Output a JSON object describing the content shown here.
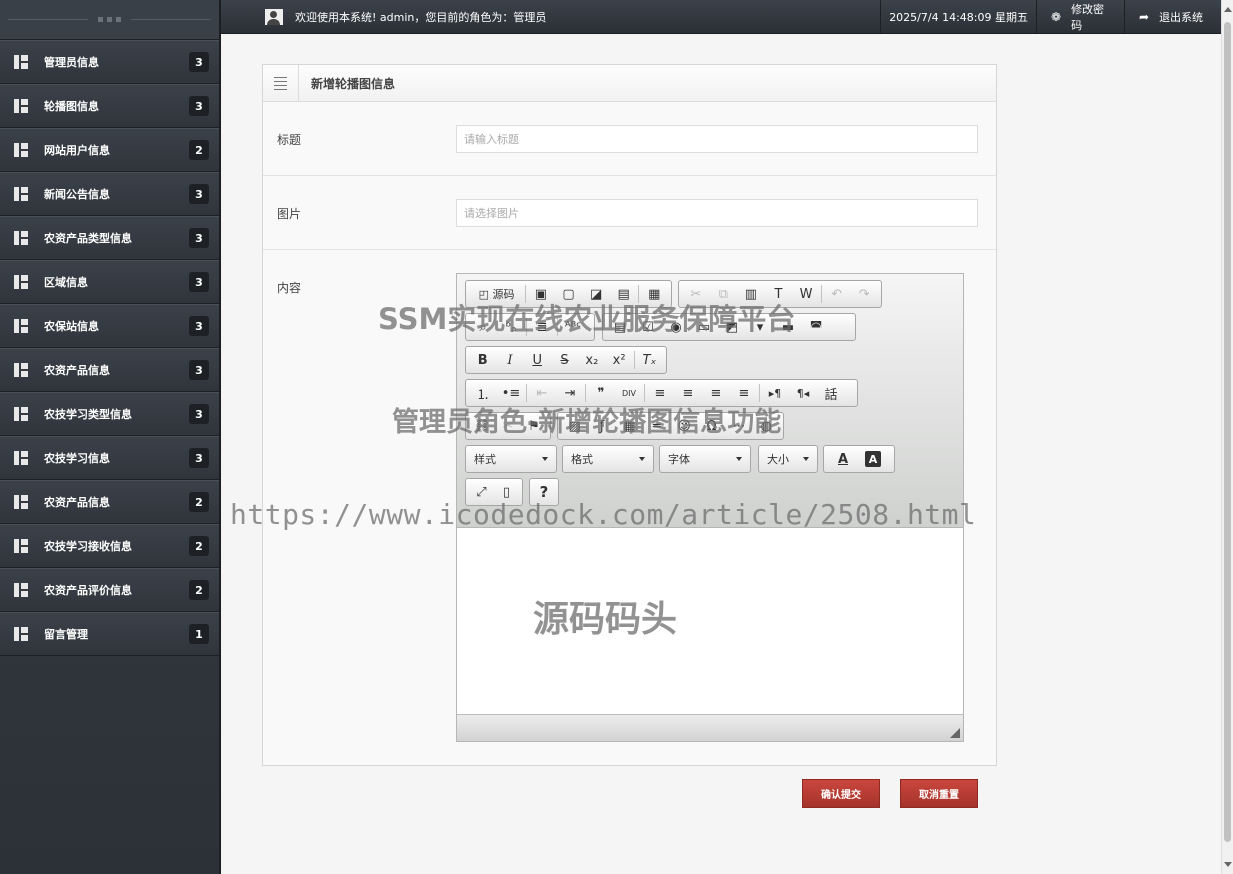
{
  "topbar": {
    "welcome": "欢迎使用本系统! admin，您目前的角色为：管理员",
    "datetime": "2025/7/4 14:48:09 星期五",
    "change_password": "修改密码",
    "logout": "退出系统",
    "user_icon": "user-icon",
    "gear_icon": "❁",
    "logout_icon": "➦"
  },
  "sidebar": {
    "items": [
      {
        "label": "管理员信息",
        "count": "3"
      },
      {
        "label": "轮播图信息",
        "count": "3"
      },
      {
        "label": "网站用户信息",
        "count": "2"
      },
      {
        "label": "新闻公告信息",
        "count": "3"
      },
      {
        "label": "农资产品类型信息",
        "count": "3"
      },
      {
        "label": "区域信息",
        "count": "3"
      },
      {
        "label": "农保站信息",
        "count": "3"
      },
      {
        "label": "农资产品信息",
        "count": "3"
      },
      {
        "label": "农技学习类型信息",
        "count": "3"
      },
      {
        "label": "农技学习信息",
        "count": "3"
      },
      {
        "label": "农资产品信息",
        "count": "2"
      },
      {
        "label": "农技学习接收信息",
        "count": "2"
      },
      {
        "label": "农资产品评价信息",
        "count": "2"
      },
      {
        "label": "留言管理",
        "count": "1"
      }
    ]
  },
  "panel": {
    "title": "新增轮播图信息",
    "fields": {
      "title": {
        "label": "标题",
        "placeholder": "请输入标题",
        "value": ""
      },
      "image": {
        "label": "图片",
        "placeholder": "请选择图片",
        "value": ""
      },
      "content": {
        "label": "内容"
      }
    }
  },
  "editor": {
    "source_label": "源码",
    "combos": {
      "style": "样式",
      "format": "格式",
      "font": "字体",
      "size": "大小"
    },
    "glyphs": {
      "save": "▣",
      "newpage": "▢",
      "preview": "◪",
      "print": "▤",
      "templates": "▦",
      "cut": "✂",
      "copy": "⧉",
      "paste": "▥",
      "paste_text": "T",
      "paste_word": "W",
      "undo": "↶",
      "redo": "↷",
      "find": "⌕",
      "replace": "ᵇₐ",
      "selectall": "≣",
      "spellcheck": "ᴬᴮᶜ",
      "form": "▤",
      "checkbox": "☑",
      "radio": "◉",
      "textfield": "▭",
      "textarea": "◩",
      "select": "▾",
      "button": "▬",
      "imagebutton": "◚",
      "hiddenfield": "⬚",
      "bold": "B",
      "italic": "I",
      "underline": "U",
      "strike": "S",
      "subscript": "x₂",
      "superscript": "x²",
      "removeformat": "Tₓ",
      "numbered_list": "⒈",
      "bulleted_list": "•≡",
      "outdent": "⇤",
      "indent": "⇥",
      "blockquote": "❞",
      "creatediv": "DIV",
      "align_left": "≡",
      "align_center": "≡",
      "align_right": "≡",
      "justify": "≡",
      "ltr": "▸¶",
      "rtl": "¶◂",
      "language": "話",
      "link": "⛓",
      "unlink": "✂",
      "anchor": "⚑",
      "image": "▨",
      "flash": "ƒ",
      "table": "▦",
      "hr": "═",
      "smiley": "☺",
      "specialchar": "Ω",
      "pagebreak": "⋯",
      "iframe": "◍",
      "text_color": "A",
      "bg_color": "A",
      "maximize": "⤢",
      "showblocks": "▯",
      "about": "?"
    }
  },
  "actions": {
    "submit": "确认提交",
    "reset": "取消重置"
  },
  "watermarks": {
    "line1": "SSM实现在线农业服务保障平台",
    "line2": "管理员角色-新增轮播图信息功能",
    "url": "https://www.icodedock.com/article/2508.html",
    "brand": "源码码头"
  }
}
